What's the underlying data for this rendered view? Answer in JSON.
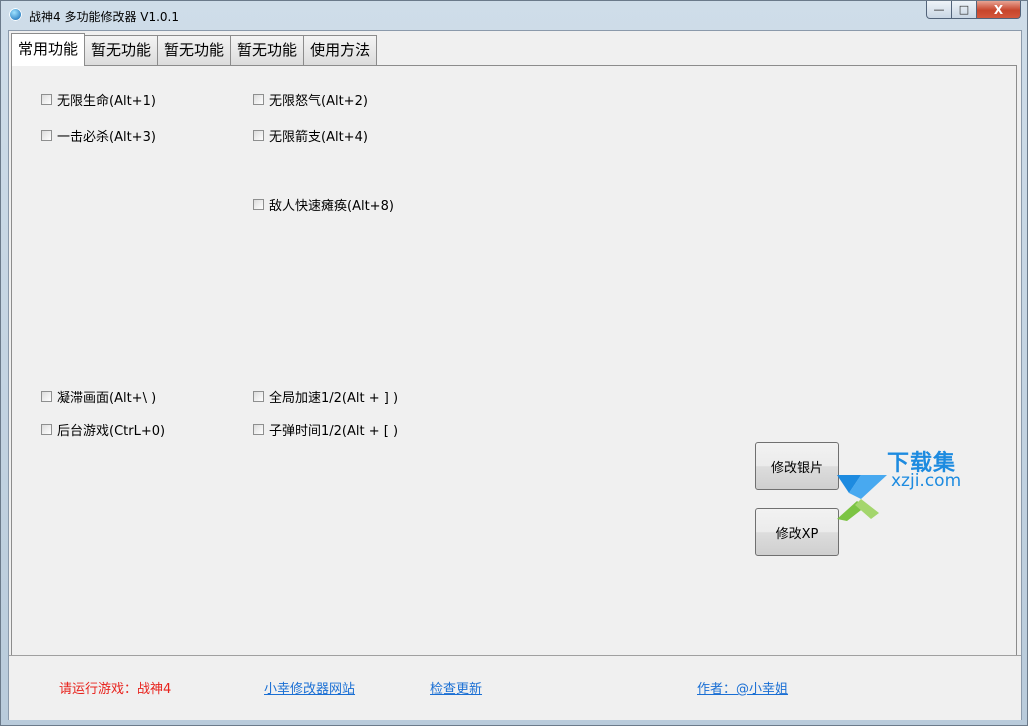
{
  "window": {
    "title": "战神4 多功能修改器  V1.0.1",
    "minimize": "—",
    "maximize": "□",
    "close": "X"
  },
  "tabs": [
    {
      "label": "常用功能"
    },
    {
      "label": "暂无功能"
    },
    {
      "label": "暂无功能"
    },
    {
      "label": "暂无功能"
    },
    {
      "label": "使用方法"
    }
  ],
  "checkboxes": {
    "infinite_health": "无限生命(Alt+1)",
    "infinite_rage": "无限怒气(Alt+2)",
    "one_hit_kill": "一击必杀(Alt+3)",
    "infinite_arrows": "无限箭支(Alt+4)",
    "enemy_quick_stun": "敌人快速瘫痪(Alt+8)",
    "freeze_frame": "凝滞画面(Alt+\\ )",
    "global_speed": "全局加速1/2(Alt + ] )",
    "background_game": "后台游戏(CtrL+0)",
    "bullet_time": "子弹时间1/2(Alt + [ )"
  },
  "buttons": {
    "modify_silver": "修改银片",
    "modify_xp": "修改XP"
  },
  "watermark": {
    "text": "下载集",
    "domain": "xzji.com"
  },
  "status": {
    "message": "请运行游戏：战神4",
    "site_link": "小幸修改器网站",
    "update_link": "检查更新",
    "author_link": "作者：@小幸姐"
  },
  "colors": {
    "status_message": "#e8231d",
    "link": "#1a6fd4",
    "watermark": "#1d8be0"
  }
}
